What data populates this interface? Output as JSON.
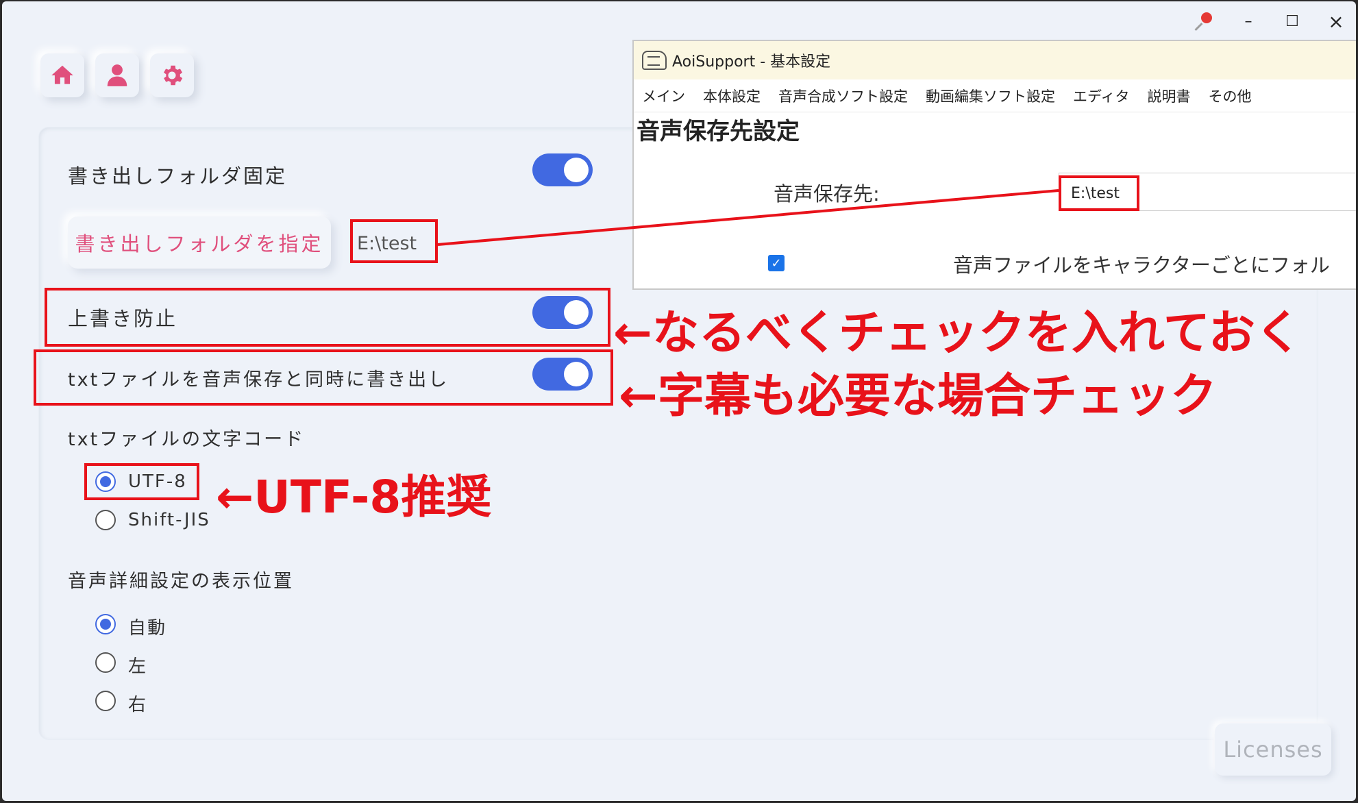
{
  "window": {
    "minimize": "–",
    "maximize": "☐",
    "close": "×"
  },
  "nav": {
    "icons": [
      "home-icon",
      "user-icon",
      "gear-icon"
    ]
  },
  "settings": {
    "fixed_folder_label": "書き出しフォルダ固定",
    "fixed_folder_on": true,
    "choose_folder_button": "書き出しフォルダを指定",
    "folder_path": "E:\\test",
    "overwrite_label": "上書き防止",
    "overwrite_on": true,
    "txt_export_label": "txtファイルを音声保存と同時に書き出し",
    "txt_export_on": true,
    "encoding_heading": "txtファイルの文字コード",
    "encoding_options": [
      {
        "label": "UTF-8",
        "checked": true
      },
      {
        "label": "Shift-JIS",
        "checked": false
      }
    ],
    "detail_position_heading": "音声詳細設定の表示位置",
    "detail_position_options": [
      {
        "label": "自動",
        "checked": true
      },
      {
        "label": "左",
        "checked": false
      },
      {
        "label": "右",
        "checked": false
      }
    ],
    "licenses_button": "Licenses"
  },
  "overlay_window": {
    "title": "AoiSupport - 基本設定",
    "menu": [
      "メイン",
      "本体設定",
      "音声合成ソフト設定",
      "動画編集ソフト設定",
      "エディタ",
      "説明書",
      "その他"
    ],
    "heading": "音声保存先設定",
    "save_dest_label": "音声保存先:",
    "save_dest_value": "E:\\test",
    "checkbox_label": "音声ファイルをキャラクターごとにフォル",
    "checkbox_checked": true
  },
  "annotations": {
    "overwrite_note": "←なるべくチェックを入れておく",
    "subtitle_note": "←字幕も必要な場合チェック",
    "utf8_note": "←UTF-8推奨",
    "accent_color": "#e8121a"
  }
}
